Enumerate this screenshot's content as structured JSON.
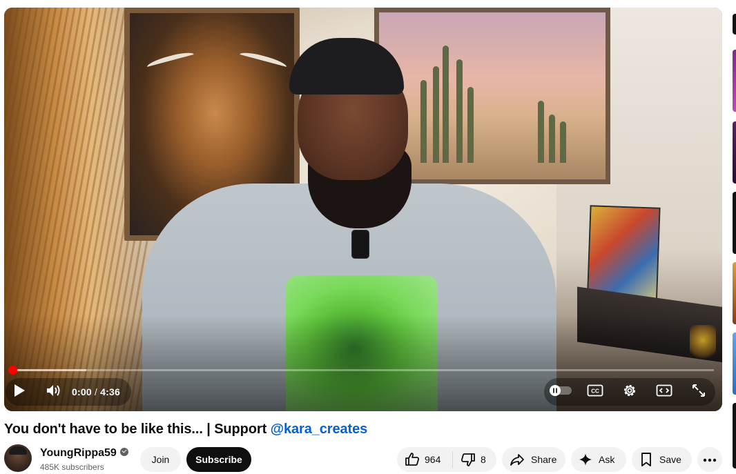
{
  "player": {
    "time_current": "0:00",
    "time_separator": "/",
    "time_total": "4:36",
    "progress_played": 0.0,
    "progress_loaded": 0.105,
    "colors": {
      "played": "#ff0000"
    },
    "controls": {
      "play": "play-icon",
      "volume": "volume-icon",
      "autoplay": "autoplay-toggle-icon",
      "captions": "captions-icon",
      "settings": "gear-icon",
      "theater": "theater-mode-icon",
      "fullscreen": "fullscreen-icon"
    }
  },
  "video": {
    "title_main": "You don't have to be like this... | Support ",
    "title_tag": "@kara_creates"
  },
  "channel": {
    "name": "YoungRippa59",
    "subscribers": "485K subscribers",
    "join_label": "Join",
    "subscribe_label": "Subscribe"
  },
  "actions": {
    "like_count": "964",
    "dislike_count": "8",
    "share_label": "Share",
    "ask_label": "Ask",
    "save_label": "Save"
  },
  "colors": {
    "link": "#065fd4",
    "pill_bg": "#f2f2f2",
    "subscribe_bg": "#0f0f0f"
  }
}
